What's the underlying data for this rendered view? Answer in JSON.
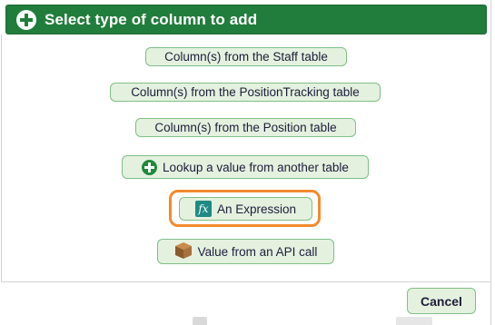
{
  "dialog": {
    "title": "Select type of column to add",
    "accent": "#217d3b",
    "highlight_color": "#f28a2e"
  },
  "options": [
    {
      "label": "Column(s) from the Staff table"
    },
    {
      "label": "Column(s) from the PositionTracking table"
    },
    {
      "label": "Column(s) from the Position table"
    },
    {
      "label": "Lookup a value from another table",
      "icon": "green-plus-icon"
    },
    {
      "label": "An Expression",
      "icon": "fx-icon",
      "icon_text": "fx"
    },
    {
      "label": "Value from an API call",
      "icon": "box-icon"
    }
  ],
  "footer": {
    "cancel_label": "Cancel"
  }
}
